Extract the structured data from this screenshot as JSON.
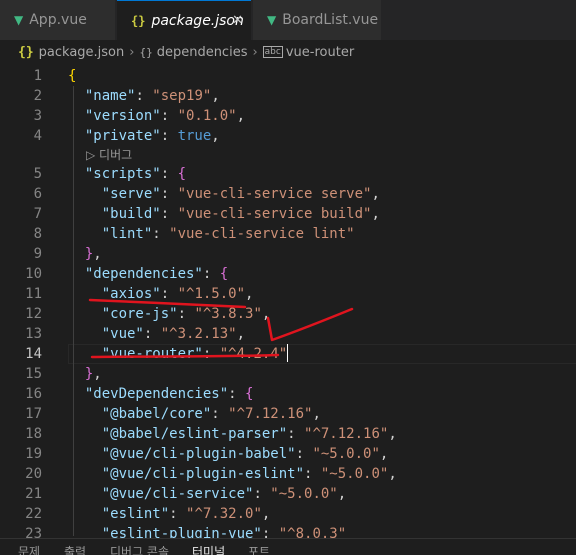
{
  "tabs": [
    {
      "label": "App.vue",
      "icon": "vue-icon",
      "active": false
    },
    {
      "label": "package.json",
      "icon": "json-braces-icon",
      "active": true
    },
    {
      "label": "BoardList.vue",
      "icon": "vue-icon",
      "active": false
    }
  ],
  "close_glyph": "✕",
  "breadcrumb": [
    "package.json",
    "dependencies",
    "vue-router"
  ],
  "codelens": "디버그",
  "lines": [
    {
      "n": "1",
      "tokens": [
        {
          "t": "{",
          "c": "br"
        }
      ]
    },
    {
      "n": "2",
      "tokens": [
        {
          "t": "  "
        },
        {
          "t": "\"name\"",
          "c": "k"
        },
        {
          "t": ": "
        },
        {
          "t": "\"sep19\"",
          "c": "s"
        },
        {
          "t": ","
        }
      ]
    },
    {
      "n": "3",
      "tokens": [
        {
          "t": "  "
        },
        {
          "t": "\"version\"",
          "c": "k"
        },
        {
          "t": ": "
        },
        {
          "t": "\"0.1.0\"",
          "c": "s"
        },
        {
          "t": ","
        }
      ]
    },
    {
      "n": "4",
      "tokens": [
        {
          "t": "  "
        },
        {
          "t": "\"private\"",
          "c": "k"
        },
        {
          "t": ": "
        },
        {
          "t": "true",
          "c": "b"
        },
        {
          "t": ","
        }
      ]
    },
    {
      "n": "5",
      "tokens": [
        {
          "t": "  "
        },
        {
          "t": "\"scripts\"",
          "c": "k"
        },
        {
          "t": ": "
        },
        {
          "t": "{",
          "c": "br2"
        }
      ]
    },
    {
      "n": "6",
      "tokens": [
        {
          "t": "    "
        },
        {
          "t": "\"serve\"",
          "c": "k"
        },
        {
          "t": ": "
        },
        {
          "t": "\"vue-cli-service serve\"",
          "c": "s"
        },
        {
          "t": ","
        }
      ]
    },
    {
      "n": "7",
      "tokens": [
        {
          "t": "    "
        },
        {
          "t": "\"build\"",
          "c": "k"
        },
        {
          "t": ": "
        },
        {
          "t": "\"vue-cli-service build\"",
          "c": "s"
        },
        {
          "t": ","
        }
      ]
    },
    {
      "n": "8",
      "tokens": [
        {
          "t": "    "
        },
        {
          "t": "\"lint\"",
          "c": "k"
        },
        {
          "t": ": "
        },
        {
          "t": "\"vue-cli-service lint\"",
          "c": "s"
        }
      ]
    },
    {
      "n": "9",
      "tokens": [
        {
          "t": "  "
        },
        {
          "t": "}",
          "c": "br2"
        },
        {
          "t": ","
        }
      ]
    },
    {
      "n": "10",
      "tokens": [
        {
          "t": "  "
        },
        {
          "t": "\"dependencies\"",
          "c": "k"
        },
        {
          "t": ": "
        },
        {
          "t": "{",
          "c": "br2"
        }
      ]
    },
    {
      "n": "11",
      "tokens": [
        {
          "t": "    "
        },
        {
          "t": "\"axios\"",
          "c": "k"
        },
        {
          "t": ": "
        },
        {
          "t": "\"^1.5.0\"",
          "c": "s"
        },
        {
          "t": ","
        }
      ]
    },
    {
      "n": "12",
      "tokens": [
        {
          "t": "    "
        },
        {
          "t": "\"core-js\"",
          "c": "k"
        },
        {
          "t": ": "
        },
        {
          "t": "\"^3.8.3\"",
          "c": "s"
        },
        {
          "t": ","
        }
      ]
    },
    {
      "n": "13",
      "tokens": [
        {
          "t": "    "
        },
        {
          "t": "\"vue\"",
          "c": "k"
        },
        {
          "t": ": "
        },
        {
          "t": "\"^3.2.13\"",
          "c": "s"
        },
        {
          "t": ","
        }
      ]
    },
    {
      "n": "14",
      "tokens": [
        {
          "t": "    "
        },
        {
          "t": "\"vue-router\"",
          "c": "k"
        },
        {
          "t": ": "
        },
        {
          "t": "\"^4.2.4\"",
          "c": "s"
        }
      ],
      "current": true
    },
    {
      "n": "15",
      "tokens": [
        {
          "t": "  "
        },
        {
          "t": "}",
          "c": "br2"
        },
        {
          "t": ","
        }
      ]
    },
    {
      "n": "16",
      "tokens": [
        {
          "t": "  "
        },
        {
          "t": "\"devDependencies\"",
          "c": "k"
        },
        {
          "t": ": "
        },
        {
          "t": "{",
          "c": "br2"
        }
      ]
    },
    {
      "n": "17",
      "tokens": [
        {
          "t": "    "
        },
        {
          "t": "\"@babel/core\"",
          "c": "k"
        },
        {
          "t": ": "
        },
        {
          "t": "\"^7.12.16\"",
          "c": "s"
        },
        {
          "t": ","
        }
      ]
    },
    {
      "n": "18",
      "tokens": [
        {
          "t": "    "
        },
        {
          "t": "\"@babel/eslint-parser\"",
          "c": "k"
        },
        {
          "t": ": "
        },
        {
          "t": "\"^7.12.16\"",
          "c": "s"
        },
        {
          "t": ","
        }
      ]
    },
    {
      "n": "19",
      "tokens": [
        {
          "t": "    "
        },
        {
          "t": "\"@vue/cli-plugin-babel\"",
          "c": "k"
        },
        {
          "t": ": "
        },
        {
          "t": "\"~5.0.0\"",
          "c": "s"
        },
        {
          "t": ","
        }
      ]
    },
    {
      "n": "20",
      "tokens": [
        {
          "t": "    "
        },
        {
          "t": "\"@vue/cli-plugin-eslint\"",
          "c": "k"
        },
        {
          "t": ": "
        },
        {
          "t": "\"~5.0.0\"",
          "c": "s"
        },
        {
          "t": ","
        }
      ]
    },
    {
      "n": "21",
      "tokens": [
        {
          "t": "    "
        },
        {
          "t": "\"@vue/cli-service\"",
          "c": "k"
        },
        {
          "t": ": "
        },
        {
          "t": "\"~5.0.0\"",
          "c": "s"
        },
        {
          "t": ","
        }
      ]
    },
    {
      "n": "22",
      "tokens": [
        {
          "t": "    "
        },
        {
          "t": "\"eslint\"",
          "c": "k"
        },
        {
          "t": ": "
        },
        {
          "t": "\"^7.32.0\"",
          "c": "s"
        },
        {
          "t": ","
        }
      ]
    },
    {
      "n": "23",
      "tokens": [
        {
          "t": "    "
        },
        {
          "t": "\"eslint-plugin-vue\"",
          "c": "k"
        },
        {
          "t": ": "
        },
        {
          "t": "\"^8.0.3\"",
          "c": "s"
        }
      ]
    }
  ],
  "panel_tabs": [
    "문제",
    "출력",
    "디버그 콘솔",
    "터미널",
    "포트"
  ],
  "panel_active": "터미널",
  "colors": {
    "accent": "#0078d4",
    "annotation": "#e0141e",
    "vue": "#41b883",
    "json": "#cbcb41"
  }
}
